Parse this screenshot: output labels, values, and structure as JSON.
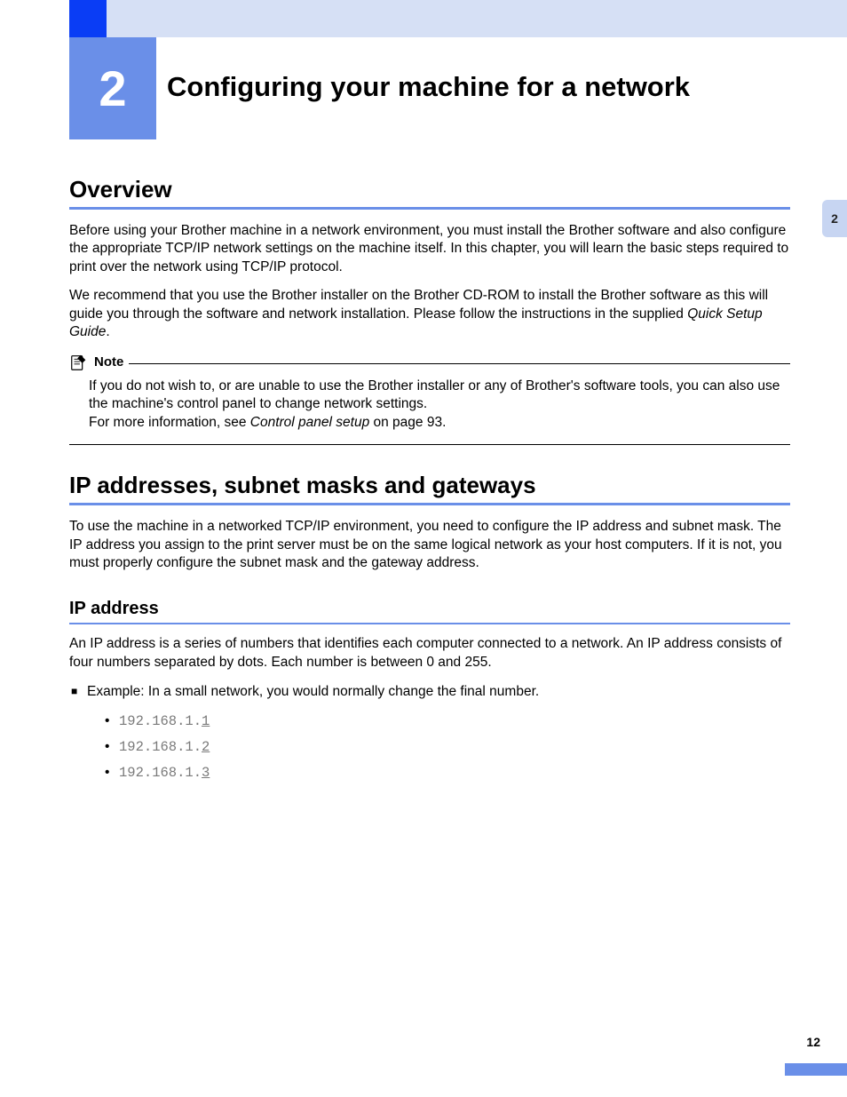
{
  "chapter": {
    "number": "2",
    "title": "Configuring your machine for a network"
  },
  "sideTab": "2",
  "pageNumber": "12",
  "overview": {
    "heading": "Overview",
    "para1": "Before using your Brother machine in a network environment, you must install the Brother software and also configure the appropriate TCP/IP network settings on the machine itself. In this chapter, you will learn the basic steps required to print over the network using TCP/IP protocol.",
    "para2a": "We recommend that you use the Brother installer on the Brother CD-ROM to install the Brother software as this will guide you through the software and network installation. Please follow the instructions in the supplied ",
    "para2_italic": "Quick Setup Guide",
    "para2b": "."
  },
  "note": {
    "label": "Note",
    "line1": "If you do not wish to, or are unable to use the Brother installer or any of Brother's software tools, you can also use the machine's control panel to change network settings.",
    "line2a": "For more information, see ",
    "line2_italic": "Control panel setup",
    "line2b": " on page 93."
  },
  "ipSection": {
    "heading": "IP addresses, subnet masks and gateways",
    "para": "To use the machine in a networked TCP/IP environment, you need to configure the IP address and subnet mask. The IP address you assign to the print server must be on the same logical network as your host computers. If it is not, you must properly configure the subnet mask and the gateway address."
  },
  "ipAddress": {
    "heading": "IP address",
    "para": "An IP address is a series of numbers that identifies each computer connected to a network. An IP address consists of four numbers separated by dots. Each number is between 0 and 255.",
    "exampleLabel": "Example: In a small network, you would normally change the final number.",
    "examples": [
      {
        "prefix": "192.168.1.",
        "last": "1"
      },
      {
        "prefix": "192.168.1.",
        "last": "2"
      },
      {
        "prefix": "192.168.1.",
        "last": "3"
      }
    ]
  }
}
